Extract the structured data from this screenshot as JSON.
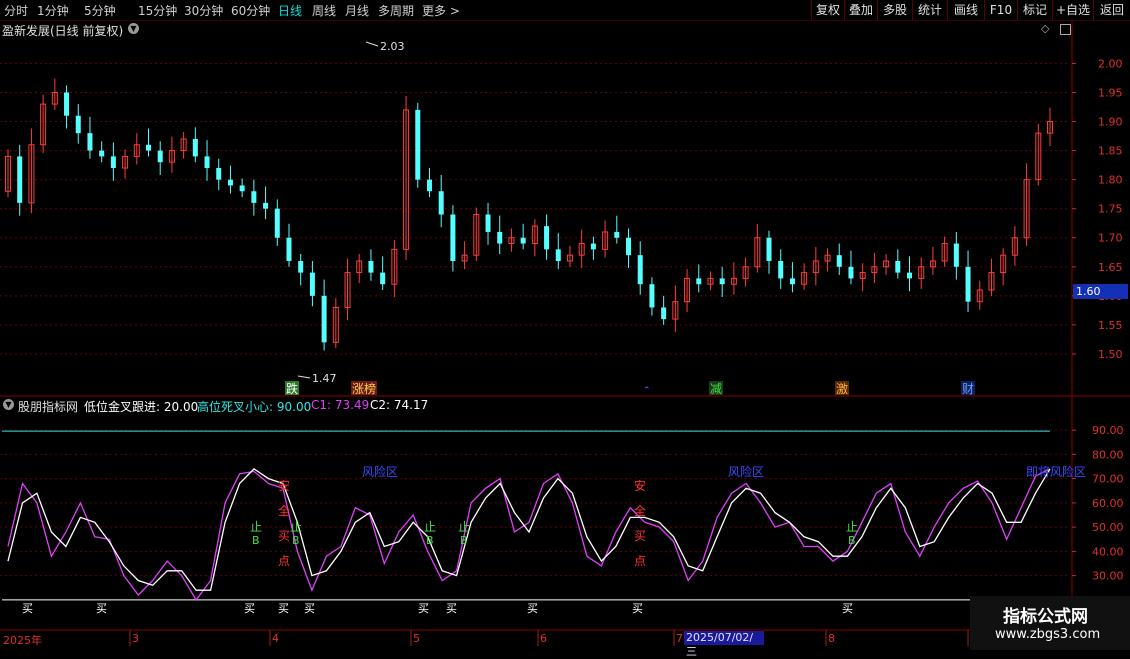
{
  "toolbar": {
    "periods": [
      "分时",
      "1分钟",
      "5分钟",
      "15分钟",
      "30分钟",
      "60分钟",
      "日线",
      "周线",
      "月线",
      "多周期",
      "更多 >"
    ],
    "active_index": 6,
    "right_buttons": [
      "复权",
      "叠加",
      "多股",
      "统计",
      "画线",
      "F10",
      "标记",
      "+自选",
      "返回"
    ]
  },
  "main_chart": {
    "title": "盈新发展(日线 前复权)",
    "price_axis": [
      "2.00",
      "1.95",
      "1.90",
      "1.85",
      "1.80",
      "1.75",
      "1.70",
      "1.65",
      "1.60",
      "1.55",
      "1.50"
    ],
    "current_price": "1.60",
    "high_label": "2.03",
    "low_label": "1.47",
    "tags": [
      "跌",
      "涨榜",
      "减",
      "激",
      "财"
    ]
  },
  "indicator": {
    "name": "股朋指标网",
    "low_label": "低位金叉跟进: 20.00",
    "high_label": "高位死叉小心: 90.00",
    "c1_label": "C1: 73.49",
    "c2_label": "C2: 74.17",
    "axis": [
      "90.00",
      "80.00",
      "70.00",
      "60.00",
      "50.00",
      "40.00",
      "30.00"
    ],
    "buy_label": "买",
    "stop_label_top": "止",
    "stop_label_bottom": "B",
    "safe_chars": [
      "安",
      "全",
      "买",
      "点"
    ],
    "risk_label": "风险区",
    "last_risk_label": "即将风险区"
  },
  "date_axis": {
    "labels": [
      "2025年",
      "3",
      "4",
      "5",
      "6",
      "7",
      "8"
    ],
    "highlight": "2025/07/02/三"
  },
  "watermark": {
    "line1": "指标公式网",
    "line2": "www.zbgs3.com"
  },
  "colors": {
    "up": "#ff3c3c",
    "down": "#54ffff",
    "c1": "#e040fb",
    "c2": "#ffffff",
    "grid": "#6a0000"
  },
  "chart_data": {
    "type": "candlestick",
    "close": [
      1.84,
      1.76,
      1.86,
      1.93,
      1.95,
      1.91,
      1.88,
      1.85,
      1.84,
      1.82,
      1.84,
      1.86,
      1.85,
      1.83,
      1.85,
      1.87,
      1.84,
      1.82,
      1.8,
      1.79,
      1.78,
      1.76,
      1.75,
      1.7,
      1.66,
      1.64,
      1.6,
      1.52,
      1.58,
      1.64,
      1.66,
      1.64,
      1.62,
      1.68,
      1.92,
      1.8,
      1.78,
      1.74,
      1.66,
      1.67,
      1.74,
      1.71,
      1.69,
      1.7,
      1.69,
      1.72,
      1.68,
      1.66,
      1.67,
      1.69,
      1.68,
      1.71,
      1.7,
      1.67,
      1.62,
      1.58,
      1.56,
      1.59,
      1.63,
      1.62,
      1.63,
      1.62,
      1.63,
      1.65,
      1.7,
      1.66,
      1.63,
      1.62,
      1.64,
      1.66,
      1.67,
      1.65,
      1.63,
      1.64,
      1.65,
      1.66,
      1.64,
      1.63,
      1.65,
      1.66,
      1.69,
      1.65,
      1.59,
      1.61,
      1.64,
      1.67,
      1.7,
      1.8,
      1.88,
      1.9
    ],
    "c1": [
      42,
      68,
      60,
      38,
      48,
      60,
      46,
      45,
      30,
      22,
      28,
      36,
      30,
      20,
      28,
      60,
      72,
      73,
      68,
      66,
      40,
      24,
      38,
      42,
      58,
      55,
      35,
      48,
      55,
      40,
      28,
      32,
      60,
      66,
      70,
      48,
      52,
      68,
      72,
      60,
      38,
      34,
      48,
      58,
      52,
      50,
      44,
      28,
      36,
      54,
      64,
      68,
      60,
      50,
      52,
      42,
      42,
      36,
      40,
      52,
      64,
      68,
      48,
      38,
      50,
      60,
      66,
      69,
      60,
      45,
      58,
      71,
      74
    ],
    "c2": [
      36,
      60,
      64,
      48,
      42,
      54,
      52,
      44,
      34,
      28,
      26,
      32,
      32,
      24,
      24,
      52,
      68,
      74,
      70,
      68,
      52,
      30,
      32,
      40,
      52,
      56,
      42,
      44,
      52,
      46,
      32,
      30,
      52,
      62,
      68,
      56,
      48,
      62,
      70,
      64,
      46,
      36,
      42,
      54,
      54,
      52,
      46,
      34,
      32,
      46,
      60,
      66,
      64,
      56,
      52,
      46,
      44,
      38,
      38,
      46,
      58,
      66,
      58,
      42,
      44,
      54,
      62,
      68,
      64,
      52,
      52,
      64,
      74
    ],
    "threshold_low": 20,
    "threshold_high": 90
  }
}
